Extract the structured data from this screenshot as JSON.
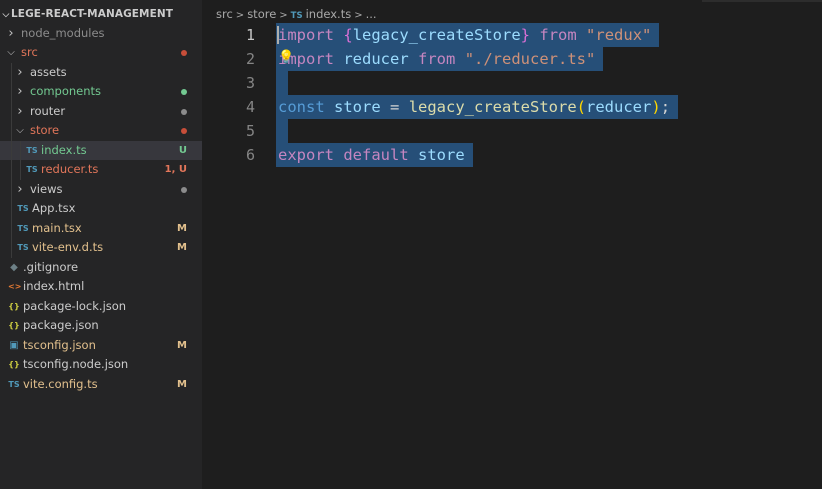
{
  "explorer": {
    "title": "LEGE-REACT-MANAGEMENT",
    "items": [
      {
        "label": "node_modules",
        "type": "folder",
        "expanded": false,
        "depth": 0,
        "color": "#8c8c8c"
      },
      {
        "label": "src",
        "type": "folder",
        "expanded": true,
        "depth": 0,
        "color": "#e2765a",
        "status": "dot",
        "statusColor": "#c74e39"
      },
      {
        "label": "assets",
        "type": "folder",
        "expanded": false,
        "depth": 1,
        "color": "#cccccc"
      },
      {
        "label": "components",
        "type": "folder",
        "expanded": false,
        "depth": 1,
        "color": "#73c991",
        "status": "dot",
        "statusColor": "#73c991"
      },
      {
        "label": "router",
        "type": "folder",
        "expanded": false,
        "depth": 1,
        "color": "#cccccc",
        "status": "dot",
        "statusColor": "#8c8c8c"
      },
      {
        "label": "store",
        "type": "folder",
        "expanded": true,
        "depth": 1,
        "color": "#e2765a",
        "status": "dot",
        "statusColor": "#c74e39"
      },
      {
        "label": "index.ts",
        "type": "ts",
        "depth": 2,
        "color": "#73c991",
        "status": "U",
        "statusColor": "#73c991",
        "selected": true
      },
      {
        "label": "reducer.ts",
        "type": "ts",
        "depth": 2,
        "color": "#e2765a",
        "status": "1, U",
        "statusColor": "#e2765a"
      },
      {
        "label": "views",
        "type": "folder",
        "expanded": false,
        "depth": 1,
        "color": "#cccccc",
        "status": "dot",
        "statusColor": "#8c8c8c"
      },
      {
        "label": "App.tsx",
        "type": "ts",
        "depth": 1,
        "color": "#cccccc"
      },
      {
        "label": "main.tsx",
        "type": "ts",
        "depth": 1,
        "color": "#e2c08d",
        "status": "M",
        "statusColor": "#e2c08d"
      },
      {
        "label": "vite-env.d.ts",
        "type": "ts",
        "depth": 1,
        "color": "#e2c08d",
        "status": "M",
        "statusColor": "#e2c08d"
      },
      {
        "label": ".gitignore",
        "type": "git",
        "depth": 0,
        "color": "#cccccc"
      },
      {
        "label": "index.html",
        "type": "html",
        "depth": 0,
        "color": "#cccccc"
      },
      {
        "label": "package-lock.json",
        "type": "json",
        "depth": 0,
        "color": "#cccccc"
      },
      {
        "label": "package.json",
        "type": "json",
        "depth": 0,
        "color": "#cccccc"
      },
      {
        "label": "tsconfig.json",
        "type": "tsconfig",
        "depth": 0,
        "color": "#e2c08d",
        "status": "M",
        "statusColor": "#e2c08d"
      },
      {
        "label": "tsconfig.node.json",
        "type": "json",
        "depth": 0,
        "color": "#cccccc"
      },
      {
        "label": "vite.config.ts",
        "type": "ts",
        "depth": 0,
        "color": "#e2c08d",
        "status": "M",
        "statusColor": "#e2c08d"
      }
    ]
  },
  "icons": {
    "ts": "TS",
    "json": "{}",
    "html": "<>",
    "git": "◆",
    "tsconfig": "▣"
  },
  "breadcrumb": [
    "src",
    "store",
    "index.ts",
    "..."
  ],
  "editor": {
    "line_numbers": [
      "1",
      "2",
      "3",
      "4",
      "5",
      "6"
    ],
    "lines": [
      [
        [
          "kw2",
          "import"
        ],
        [
          "pun",
          " "
        ],
        [
          "brk",
          "{"
        ],
        [
          "var",
          "legacy_createStore"
        ],
        [
          "brk",
          "}"
        ],
        [
          "pun",
          " "
        ],
        [
          "kw2",
          "from"
        ],
        [
          "pun",
          " "
        ],
        [
          "str",
          "\"redux\""
        ]
      ],
      [
        [
          "kw2",
          "import"
        ],
        [
          "pun",
          " "
        ],
        [
          "var",
          "reducer"
        ],
        [
          "pun",
          " "
        ],
        [
          "kw2",
          "from"
        ],
        [
          "pun",
          " "
        ],
        [
          "str",
          "\"./reducer.ts\""
        ]
      ],
      [],
      [
        [
          "kw",
          "const"
        ],
        [
          "pun",
          " "
        ],
        [
          "var",
          "store"
        ],
        [
          "pun",
          " = "
        ],
        [
          "fn",
          "legacy_createStore"
        ],
        [
          "brk2",
          "("
        ],
        [
          "var",
          "reducer"
        ],
        [
          "brk2",
          ")"
        ],
        [
          "pun",
          ";"
        ]
      ],
      [],
      [
        [
          "kw2",
          "export"
        ],
        [
          "pun",
          " "
        ],
        [
          "kw2",
          "default"
        ],
        [
          "pun",
          " "
        ],
        [
          "var",
          "store"
        ]
      ]
    ],
    "lightbulb_icon": "lightbulb-icon"
  }
}
